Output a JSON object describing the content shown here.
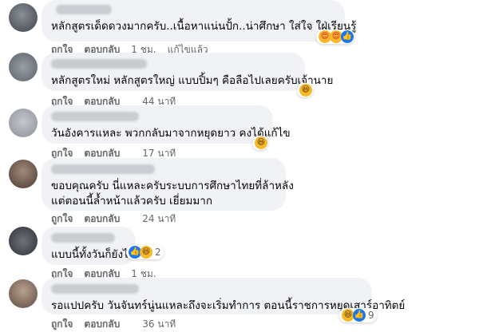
{
  "actions": {
    "like": "ถูกใจ",
    "reply": "ตอบกลับ",
    "edited": "แก้ไขแล้ว"
  },
  "comments": [
    {
      "lines": [
        "หลักสูตรเด็ดดวงมากครับ..เนื้อหาแน่นปั้ก..น่าศึกษา ใส่ใจ ใฝ่เรียนรู้"
      ],
      "time": "1 ชม.",
      "reaction_count": ""
    },
    {
      "lines": [
        "หลักสูตรใหม่ หลักสูตรใหญ่ แบบปิ้มๆ คือลือไปเลยครับเจ้านาย"
      ],
      "time": "44 นาที",
      "reaction_count": ""
    },
    {
      "lines": [
        "วันอังคารแหละ พวกกลับมาจากหยุดยาว คงได้แก้ไข"
      ],
      "time": "17 นาที",
      "reaction_count": ""
    },
    {
      "lines": [
        "ขอบคุณครับ นี่แหละครับระบบการศึกษาไทยที่ล้าหลัง",
        "แต่ตอนนี้ล้ำหน้าแล้วครับ เยี่ยมมาก"
      ],
      "time": "24 นาที",
      "reaction_count": ""
    },
    {
      "lines": [
        "แบบนี้ทั้งวันก็ยังได้"
      ],
      "time": "1 ชม.",
      "reaction_count": "2"
    },
    {
      "lines": [
        "รอแปปครับ วันจันทร์นู่นแหละถึงจะเริ่มทำการ ตอนนี้ราชการหยุดเสาร์อาทิตย์"
      ],
      "time": "36 นาที",
      "reaction_count": "9"
    }
  ],
  "icons": {
    "like": "like-icon",
    "love_eyes": "heart-eyes-icon",
    "haha": "haha-icon"
  },
  "colors": {
    "bubble": "#f0f2f5",
    "meta": "#65676b",
    "like_blue": "#1877f2",
    "emoji_yellow": "#f7b928"
  }
}
